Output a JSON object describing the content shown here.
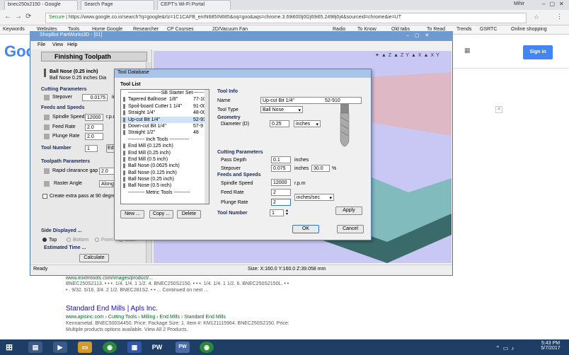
{
  "tabs": [
    {
      "label": "bnec250x2150 - Google"
    },
    {
      "label": "Search Page"
    },
    {
      "label": "CEPT's Wi-Fi Portal"
    }
  ],
  "browser": {
    "user": "Mihir",
    "secure": "Secure",
    "url": "https://www.google.co.in/search?q=google&rlz=1C1CAFB_enIN685IN685&oq=goo&aqs=chrome.3.69i60l3j0l2j69i65.2498j0j4&sourceid=chrome&ie=UT",
    "bookmarks": [
      "Keywords",
      "Websites",
      "Tools",
      "Home Google",
      "Researcher",
      "CP Courses",
      "2D/Vacuum Fan",
      "Radio",
      "To Know",
      "Old tabs",
      "To Read",
      "Trends",
      "GSRTC",
      "Online shopping"
    ]
  },
  "google": {
    "logo": "Goo",
    "signin": "Sign in"
  },
  "shopbot": {
    "title": "ShopBot PartWorks3D - [01]",
    "menu": [
      "File",
      "View",
      "Help"
    ],
    "toolpath_title": "Finishing Toolpath",
    "tool_name": "Ball Nose (0.25 inch)",
    "tool_desc": "Ball Nose 0.25 inches Dia",
    "cutting_params": "Cutting Parameters",
    "stepover_label": "Stepover",
    "stepover_value": "0.0175",
    "stepover_unit": "inches",
    "feeds_label": "Feeds and Speeds",
    "spindle_label": "Spindle Speed",
    "spindle_value": "12000",
    "spindle_unit": "r.p.m",
    "feed_label": "Feed Rate",
    "feed_value": "2.0",
    "plunge_label": "Plunge Rate",
    "plunge_value": "2.0",
    "tool_number_label": "Tool Number",
    "tool_number": "1",
    "edit": "Edi",
    "toolpath_params": "Toolpath Parameters",
    "rapid_label": "Rapid clearance gap",
    "rapid_value": "2.0",
    "raster_label": "Raster Angle",
    "raster_value": "Along X",
    "extra_pass": "Create extra pass at 90 degrees t",
    "side_displayed": "Side Displayed ...",
    "top": "Top",
    "bottom": "Bottom",
    "front": "Front",
    "back": "Back",
    "estimated": "Estimated Time ...",
    "calculate": "Calculate",
    "status": "Ready",
    "size": "Size: X:160.0 Y:160.0 Z:39.058 mm"
  },
  "dialog": {
    "title": "Tool Database",
    "tool_list_label": "Tool List",
    "tools": [
      {
        "a": "--------------------SB Starter Set-------",
        "b": "",
        "c": ""
      },
      {
        "a": "Tapered Ballnose",
        "b": "1/8\"",
        "c": "77-10"
      },
      {
        "a": "Spoil-board Cutter",
        "b": "1 1/4\"",
        "c": "91-00"
      },
      {
        "a": "Straight 1/4\"",
        "b": "",
        "c": "48-00"
      },
      {
        "a": "Up-cut Bit 1/4\"",
        "b": "",
        "c": "52-91"
      },
      {
        "a": "Down-cut Bit 1/4\"",
        "b": "",
        "c": "57-9"
      },
      {
        "a": "Straight 1/2\"",
        "b": "",
        "c": "48"
      },
      {
        "a": "---------- Inch Tools ------------",
        "b": "",
        "c": ""
      },
      {
        "a": "End Mill (0.125 inch)",
        "b": "",
        "c": ""
      },
      {
        "a": "End Mill (0.25 inch)",
        "b": "",
        "c": ""
      },
      {
        "a": "End Mill (0.5 inch)",
        "b": "",
        "c": ""
      },
      {
        "a": "Ball Nose (0.0625 inch)",
        "b": "",
        "c": ""
      },
      {
        "a": "Ball Nose (0.125 inch)",
        "b": "",
        "c": ""
      },
      {
        "a": "Ball Nose (0.25 inch)",
        "b": "",
        "c": ""
      },
      {
        "a": "Ball Nose (0.5 inch)",
        "b": "",
        "c": ""
      },
      {
        "a": "---------- Metric Tools ----------",
        "b": "",
        "c": ""
      }
    ],
    "new": "New ...",
    "copy": "Copy ...",
    "delete": "Delete",
    "tool_info": "Tool Info",
    "name_label": "Name",
    "name_value": "Up-cut Bit 1/4\"",
    "name_code": "52-910",
    "type_label": "Tool Type",
    "type_value": "Ball Nose",
    "geometry": "Geometry",
    "diameter_label": "Diameter (D)",
    "diameter_value": "0.25",
    "diameter_unit": "inches",
    "cutting": "Cutting Parameters",
    "pass_label": "Pass Depth",
    "pass_value": "0.1",
    "pass_unit": "inches",
    "stepover_label": "Stepover",
    "stepover_value": "0.075",
    "stepover_unit": "inches",
    "stepover_pct": "30.0",
    "pct": "%",
    "feeds": "Feeds and Speeds",
    "spindle_label": "Spindle Speed",
    "spindle_value": "12000",
    "spindle_unit": "r.p.m",
    "feed_label": "Feed Rate",
    "feed_value": "2",
    "plunge_label": "Plunge Rate",
    "plunge_value": "2",
    "rate_unit": "inches/sec",
    "tool_number_label": "Tool Number",
    "tool_number": "1",
    "apply": "Apply",
    "ok": "OK",
    "cancel": "Cancel"
  },
  "results": {
    "snippet1": "www.mixtmtools.com/images/product/...",
    "snippet2": "BNEC250S2113. • • •. 1/4. 1/4. 1 1/2. 4. BNEC250S2150. • • •. 1/4. 1/4. 1 1/2. 6. BNEC250S2150L. • •",
    "snippet3": "• . 9/32. 5/16. 3/4. 2 1/2. BNEC281S2. • • ... Continued on next ...",
    "title2": "Standard End Mills | Apls Inc.",
    "url2": "www.apisinc.com › Cutting Tools › Milling › End Mills › Standard End Mills",
    "desc2a": "Kennametal. BNEC500S4450. Price: Package Size: 1. Item #: KM121115964. BNEC250S2150. Price:",
    "desc2b": "Multiple products options available. View All 2 Products."
  },
  "taskbar": {
    "time": "5:43 PM",
    "date": "5/7/2017",
    "pw": "PW"
  }
}
